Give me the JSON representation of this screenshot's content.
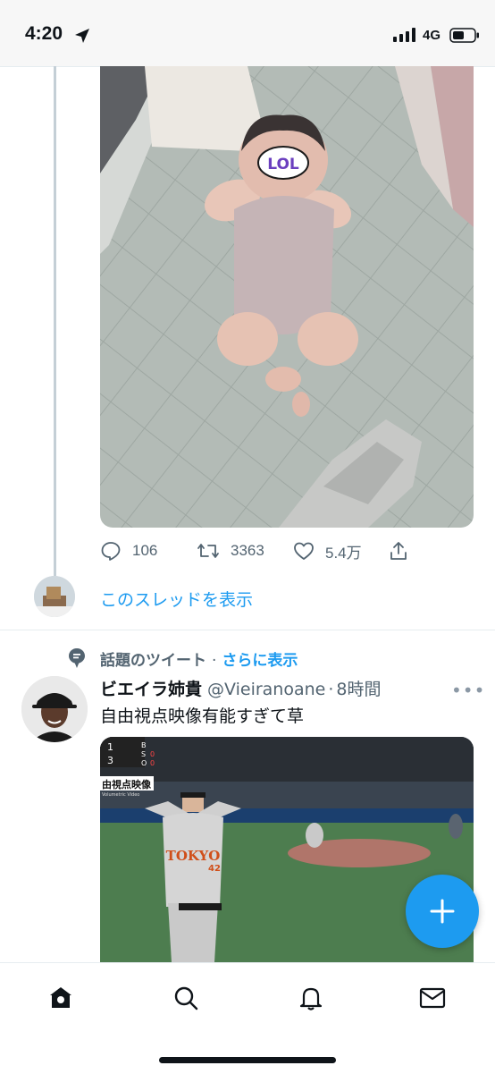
{
  "status_bar": {
    "time": "4:20",
    "network": "4G",
    "location_icon": "location-arrow-icon",
    "signal_icon": "signal-dots-icon",
    "battery_icon": "battery-icon"
  },
  "previous_tweet": {
    "image_overlay_text": "LOL",
    "actions": {
      "reply_count": "106",
      "retweet_count": "3363",
      "like_count": "5.4万",
      "reply_icon": "reply-icon",
      "retweet_icon": "retweet-icon",
      "like_icon": "heart-icon",
      "share_icon": "share-icon"
    },
    "show_thread_label": "このスレッドを表示"
  },
  "trending_tweet": {
    "label": "話題のツイート",
    "separator": "·",
    "show_more": "さらに表示",
    "author_name": "ビエイラ姉貴",
    "author_handle": "@Vieiranoane",
    "time_separator": "·",
    "time": "8時間",
    "text": "自由視点映像有能すぎて草",
    "image": {
      "score_inning_top": "1",
      "score_inning": "3",
      "count_b": "B",
      "count_s": "S",
      "count_o": "O",
      "count_s_val": "0",
      "count_o_val": "0",
      "caption": "由視点映像",
      "caption_sub": "Volumetric Video",
      "uniform_text": "TOKYO",
      "uniform_number": "42"
    }
  },
  "fab": {
    "icon": "plus-icon"
  },
  "tab_bar": {
    "home_icon": "home-icon",
    "search_icon": "search-icon",
    "notifications_icon": "bell-icon",
    "messages_icon": "mail-icon"
  },
  "colors": {
    "accent": "#1d9bf0",
    "secondary_text": "#536471",
    "divider": "#e6ecf0"
  }
}
